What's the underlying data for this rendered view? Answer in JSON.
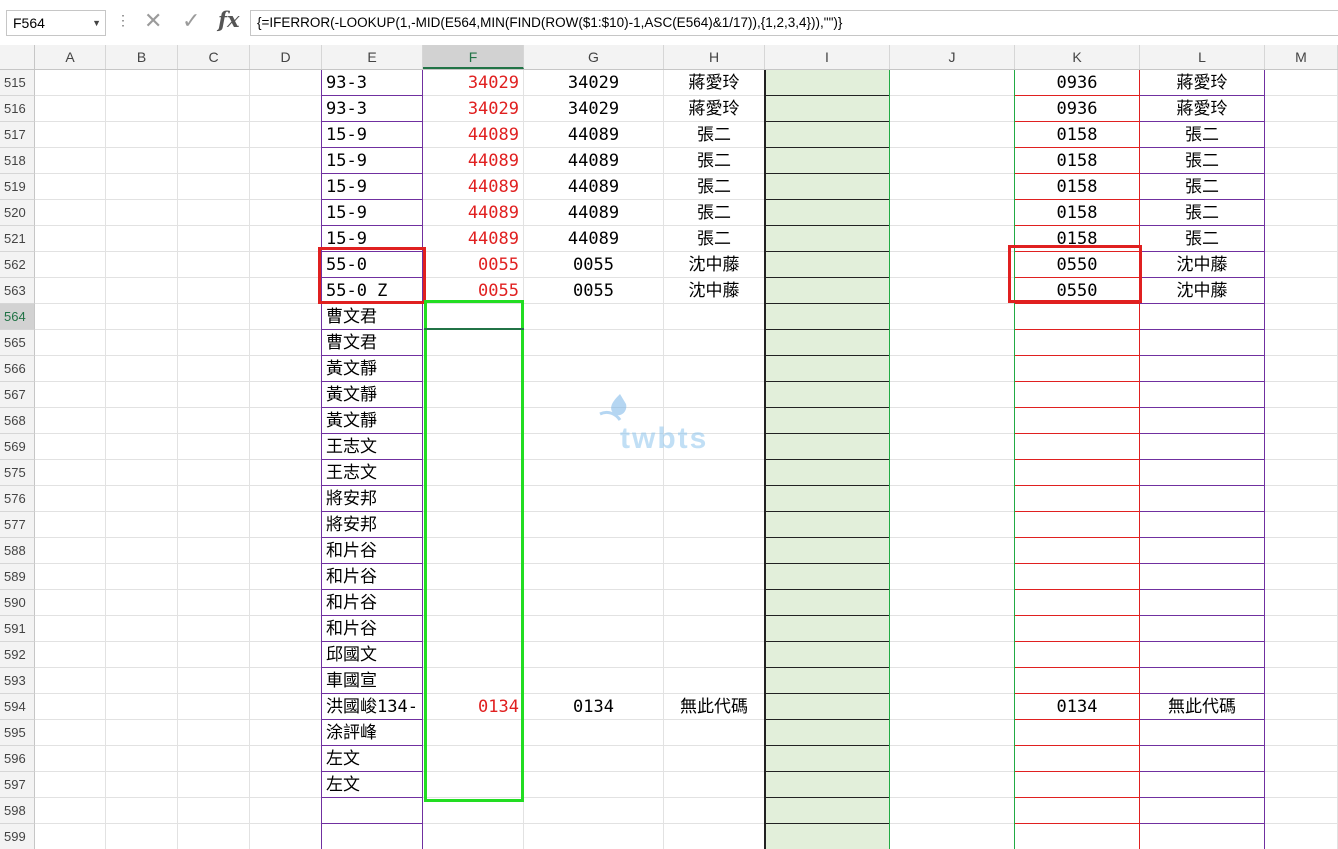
{
  "name_box": {
    "value": "F564"
  },
  "formula_bar": {
    "dots": "⋮",
    "cancel_glyph": "✕",
    "enter_glyph": "✓",
    "fx_label": "fx",
    "formula": "{=IFERROR(-LOOKUP(1,-MID(E564,MIN(FIND(ROW($1:$10)-1,ASC(E564)&1/17)),{1,2,3,4})),\"\")}"
  },
  "columns": [
    "A",
    "B",
    "C",
    "D",
    "E",
    "F",
    "G",
    "H",
    "I",
    "J",
    "K",
    "L",
    "M"
  ],
  "selected_column": "F",
  "selected_row": "564",
  "rows": [
    {
      "n": "515",
      "E": "93-3",
      "F": "34029",
      "G": "34029",
      "H": "蔣愛玲",
      "K": "0936",
      "L": "蔣愛玲"
    },
    {
      "n": "516",
      "E": "93-3",
      "F": "34029",
      "G": "34029",
      "H": "蔣愛玲",
      "K": "0936",
      "L": "蔣愛玲"
    },
    {
      "n": "517",
      "E": "15-9",
      "F": "44089",
      "G": "44089",
      "H": "張二",
      "K": "0158",
      "L": "張二"
    },
    {
      "n": "518",
      "E": "15-9",
      "F": "44089",
      "G": "44089",
      "H": "張二",
      "K": "0158",
      "L": "張二"
    },
    {
      "n": "519",
      "E": "15-9",
      "F": "44089",
      "G": "44089",
      "H": "張二",
      "K": "0158",
      "L": "張二"
    },
    {
      "n": "520",
      "E": "15-9",
      "F": "44089",
      "G": "44089",
      "H": "張二",
      "K": "0158",
      "L": "張二"
    },
    {
      "n": "521",
      "E": "15-9",
      "F": "44089",
      "G": "44089",
      "H": "張二",
      "K": "0158",
      "L": "張二"
    },
    {
      "n": "562",
      "E": "55-0",
      "F": "0055",
      "G": "0055",
      "H": "沈中藤",
      "K": "0550",
      "L": "沈中藤"
    },
    {
      "n": "563",
      "E": "55-0 Z",
      "F": "0055",
      "G": "0055",
      "H": "沈中藤",
      "K": "0550",
      "L": "沈中藤"
    },
    {
      "n": "564",
      "E": "曹文君",
      "F": "",
      "G": "",
      "H": "",
      "K": "",
      "L": ""
    },
    {
      "n": "565",
      "E": "曹文君",
      "F": "",
      "G": "",
      "H": "",
      "K": "",
      "L": ""
    },
    {
      "n": "566",
      "E": "黃文靜",
      "F": "",
      "G": "",
      "H": "",
      "K": "",
      "L": ""
    },
    {
      "n": "567",
      "E": "黃文靜",
      "F": "",
      "G": "",
      "H": "",
      "K": "",
      "L": ""
    },
    {
      "n": "568",
      "E": "黃文靜",
      "F": "",
      "G": "",
      "H": "",
      "K": "",
      "L": ""
    },
    {
      "n": "569",
      "E": "王志文",
      "F": "",
      "G": "",
      "H": "",
      "K": "",
      "L": ""
    },
    {
      "n": "575",
      "E": "王志文",
      "F": "",
      "G": "",
      "H": "",
      "K": "",
      "L": ""
    },
    {
      "n": "576",
      "E": "將安邦",
      "F": "",
      "G": "",
      "H": "",
      "K": "",
      "L": ""
    },
    {
      "n": "577",
      "E": "將安邦",
      "F": "",
      "G": "",
      "H": "",
      "K": "",
      "L": ""
    },
    {
      "n": "588",
      "E": "和片谷",
      "F": "",
      "G": "",
      "H": "",
      "K": "",
      "L": ""
    },
    {
      "n": "589",
      "E": "和片谷",
      "F": "",
      "G": "",
      "H": "",
      "K": "",
      "L": ""
    },
    {
      "n": "590",
      "E": "和片谷",
      "F": "",
      "G": "",
      "H": "",
      "K": "",
      "L": ""
    },
    {
      "n": "591",
      "E": "和片谷",
      "F": "",
      "G": "",
      "H": "",
      "K": "",
      "L": ""
    },
    {
      "n": "592",
      "E": "邱國文",
      "F": "",
      "G": "",
      "H": "",
      "K": "",
      "L": ""
    },
    {
      "n": "593",
      "E": "車國宣",
      "F": "",
      "G": "",
      "H": "",
      "K": "",
      "L": ""
    },
    {
      "n": "594",
      "E": "洪國峻134-",
      "F": "0134",
      "G": "0134",
      "H": "無此代碼",
      "K": "0134",
      "L": "無此代碼"
    },
    {
      "n": "595",
      "E": "涂評峰",
      "F": "",
      "G": "",
      "H": "",
      "K": "",
      "L": ""
    },
    {
      "n": "596",
      "E": "左文",
      "F": "",
      "G": "",
      "H": "",
      "K": "",
      "L": ""
    },
    {
      "n": "597",
      "E": "左文",
      "F": "",
      "G": "",
      "H": "",
      "K": "",
      "L": ""
    },
    {
      "n": "598",
      "E": "",
      "F": "",
      "G": "",
      "H": "",
      "K": "",
      "L": ""
    },
    {
      "n": "599",
      "E": "",
      "F": "",
      "G": "",
      "H": "",
      "K": "",
      "L": ""
    }
  ],
  "colors": {
    "accent_green": "#217346",
    "highlight_red": "#e02020",
    "highlight_green": "#22dd22",
    "purple_border": "#7030a0",
    "fill_I": "#e2efda"
  },
  "watermark": {
    "text": "twbts"
  }
}
